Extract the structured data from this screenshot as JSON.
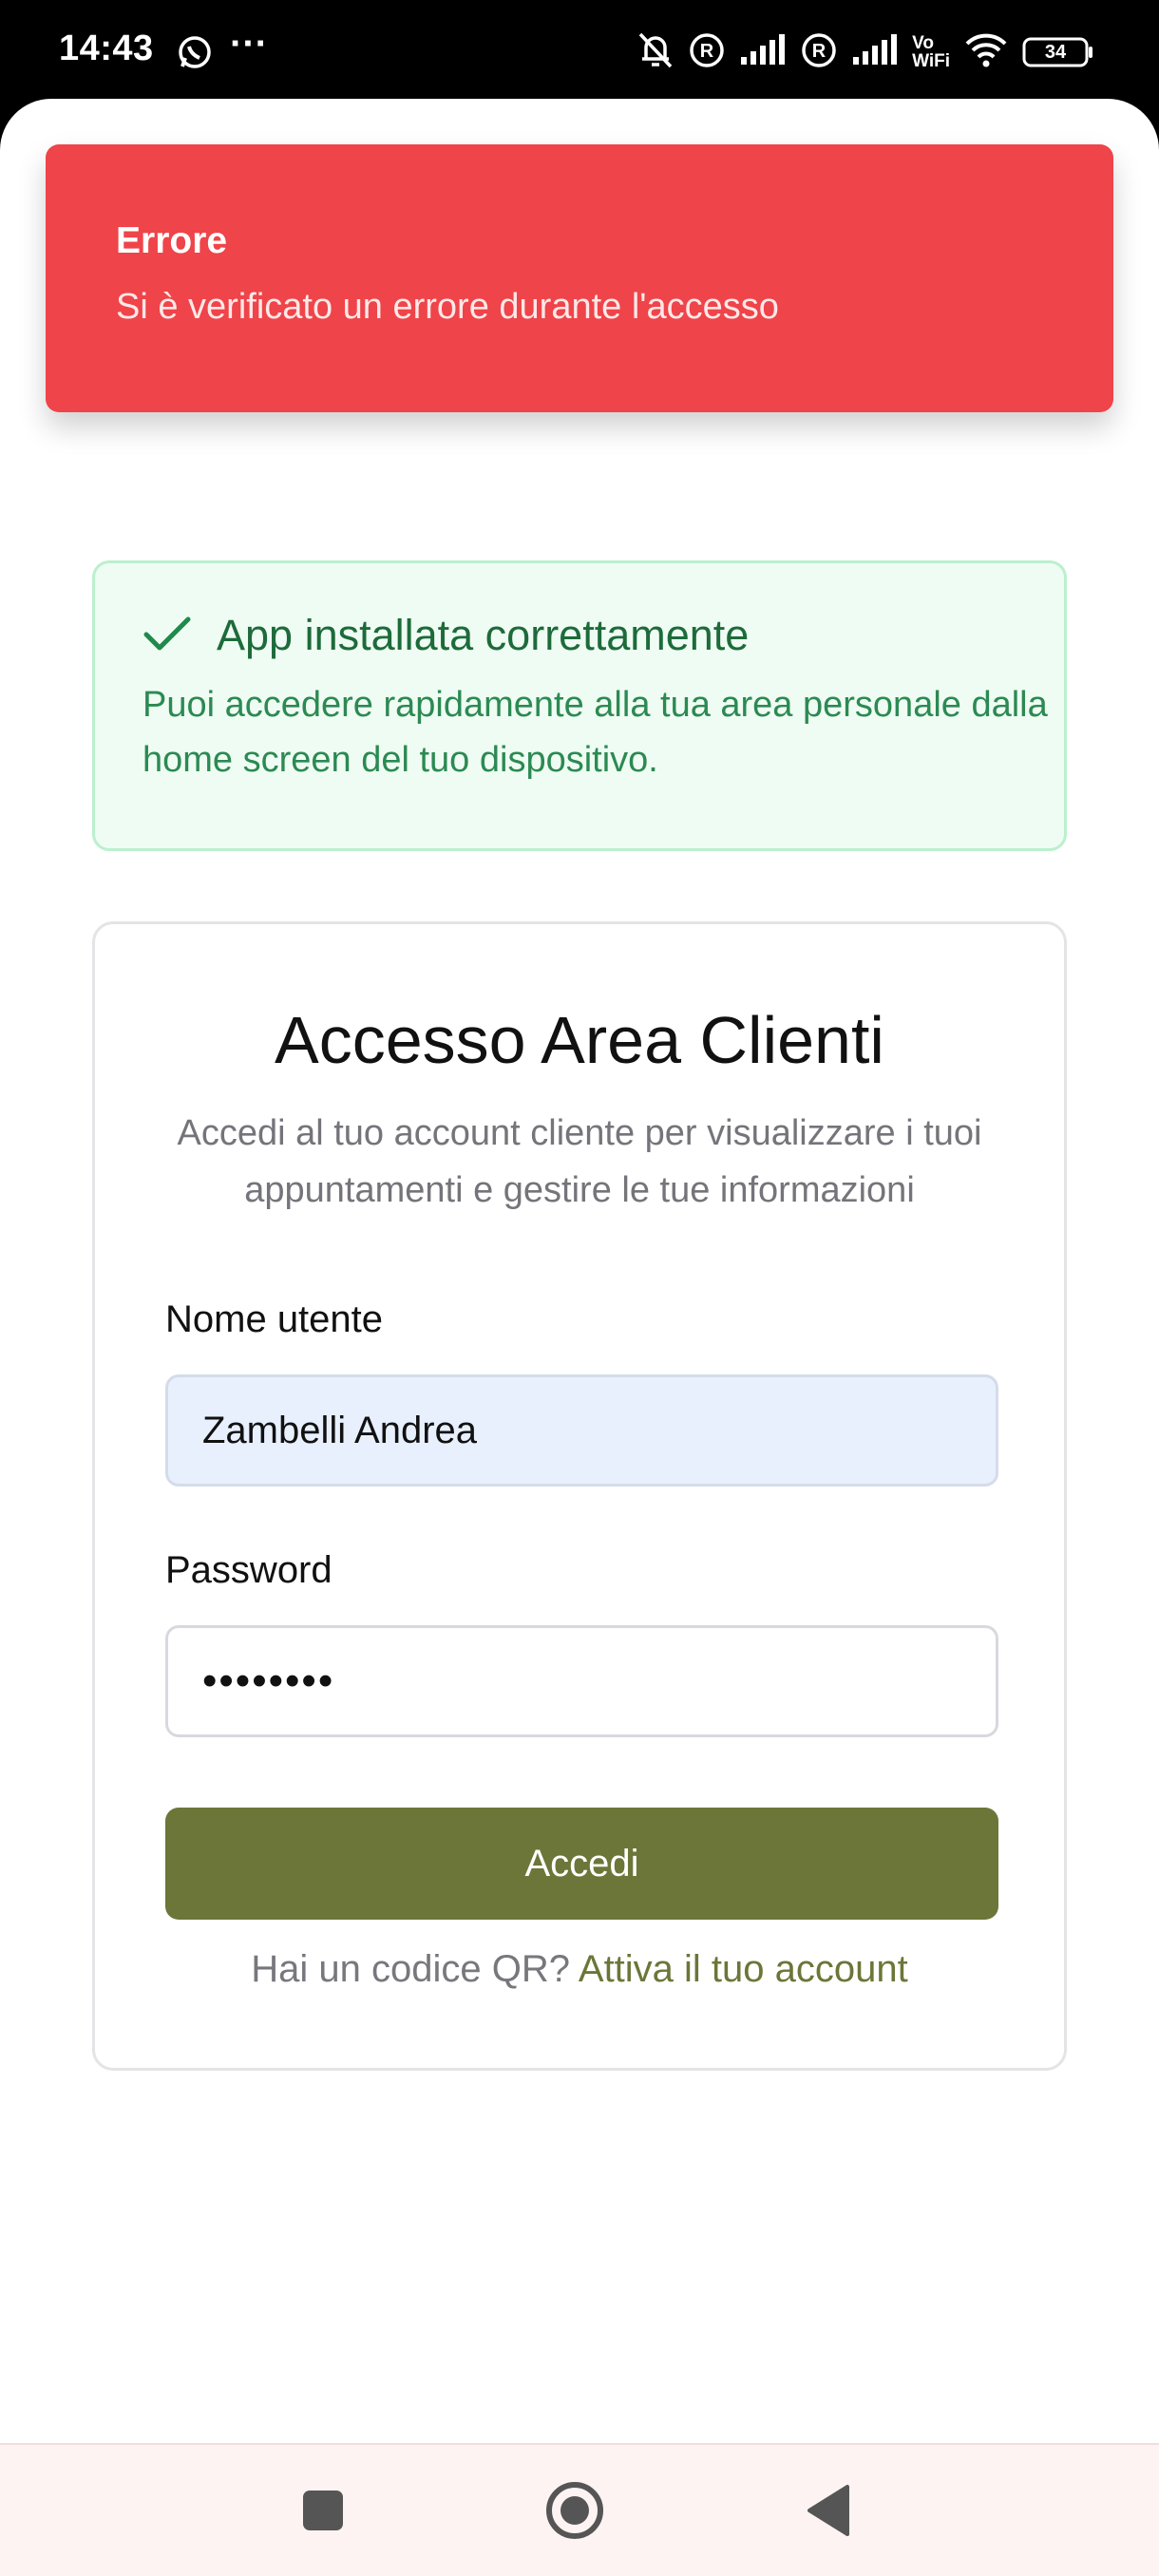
{
  "status_bar": {
    "time": "14:43",
    "battery": "34",
    "icons": [
      "whatsapp-icon",
      "more-dots",
      "bell-off-icon",
      "roaming-icon",
      "signal-icon",
      "roaming-icon",
      "signal-icon",
      "vowifi-icon",
      "wifi-icon",
      "battery-icon"
    ],
    "vowifi_top": "Vo",
    "vowifi_bottom": "WiFi",
    "dots": "···"
  },
  "toast": {
    "title": "Errore",
    "message": "Si è verificato un errore durante l'accesso",
    "color": "#ef4449"
  },
  "install_notice": {
    "title": "App installata correttamente",
    "text": "Puoi accedere rapidamente alla tua area personale dalla home screen del tuo dispositivo.",
    "icon": "check-icon"
  },
  "login": {
    "title": "Accesso Area Clienti",
    "subtitle": "Accedi al tuo account cliente per visualizzare i tuoi appuntamenti e gestire le tue informazioni",
    "username_label": "Nome utente",
    "username_value": "Zambelli Andrea",
    "password_label": "Password",
    "password_value": "••••••••",
    "submit_label": "Accedi",
    "qr_prompt": "Hai un codice QR?",
    "qr_link": "Attiva il tuo account",
    "accent_color": "#6b7638"
  },
  "nav_bar": {
    "buttons": [
      "recents-icon",
      "home-icon",
      "back-icon"
    ]
  }
}
